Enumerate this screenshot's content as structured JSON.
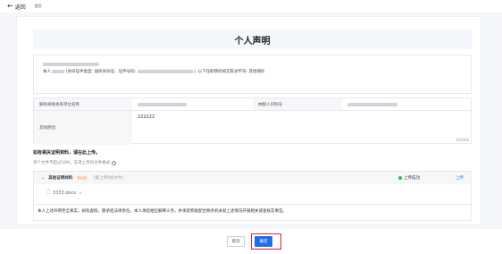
{
  "topbar": {
    "back_label": "返回",
    "breadcrumb": "首页"
  },
  "page": {
    "title": "个人声明"
  },
  "declaration": {
    "line2_prefix": "本人",
    "line2_idtype": "(身份证件类型: 居民身份证、证件号码:",
    "line2_suffix": "), 以下任职情形如实陈述不符: 其他情形"
  },
  "form": {
    "label_company": "解除关联关系单位名称",
    "label_tax_id": "纳税人识别号",
    "label_other": "其他原因",
    "other_value": "222222",
    "counter": "6/2000"
  },
  "upload": {
    "title": "如有相关证明资料，请在此上传。",
    "hint": "单个文件不超过10M，支持上传的文件格式",
    "hint_icon": "info-icon"
  },
  "attachment": {
    "name": "其他证明材料",
    "tag": "非必填",
    "note": "(限上传9份文件)",
    "status": "上传成功",
    "status_color": "#3bb346",
    "upload_link": "上传",
    "file_name": "3333.docx",
    "file_remove": "×",
    "disclaimer": "本人上述声明完全真实，如有虚假，愿承担法律责任。本人承担相应解释义务，并承诺积极配合税务机关就上述情况开展相关调查核实事宜。"
  },
  "footer": {
    "cancel_label": "取消",
    "ok_label": "确定",
    "highlight_color": "#e0212b",
    "primary_color": "#1f6feb"
  }
}
